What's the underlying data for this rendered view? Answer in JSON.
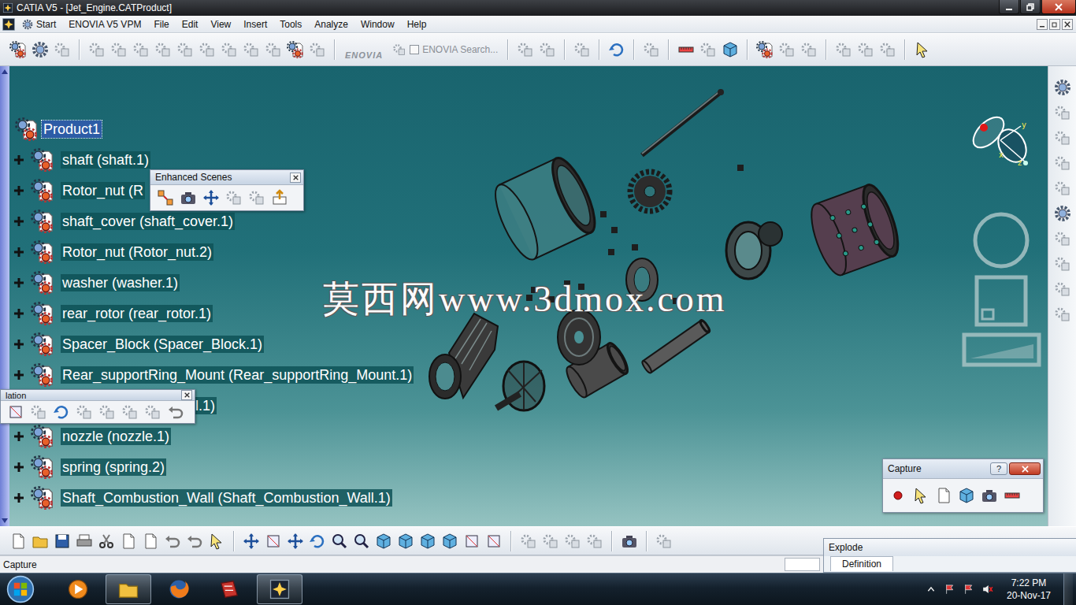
{
  "window": {
    "title": "CATIA V5 - [Jet_Engine.CATProduct]"
  },
  "menu": [
    "Start",
    "ENOVIA V5 VPM",
    "File",
    "Edit",
    "View",
    "Insert",
    "Tools",
    "Analyze",
    "Window",
    "Help"
  ],
  "toolbar": {
    "logo": "ENOVIA",
    "search": {
      "label": "ENOVIA Search...",
      "checked": false,
      "disabled": true
    }
  },
  "tree": {
    "root": {
      "label": "Product1",
      "selected": true
    },
    "items": [
      {
        "label": "shaft (shaft.1)",
        "kind": "row",
        "expanded": false
      },
      {
        "label": "Rotor_nut (R",
        "kind": "row",
        "expanded": false
      },
      {
        "label": "shaft_cover (shaft_cover.1)",
        "kind": "row",
        "expanded": false
      },
      {
        "label": "Rotor_nut (Rotor_nut.2)",
        "kind": "row",
        "expanded": false
      },
      {
        "label": "washer (washer.1)",
        "kind": "row",
        "expanded": false
      },
      {
        "label": "rear_rotor (rear_rotor.1)",
        "kind": "row",
        "expanded": false
      },
      {
        "label": "Spacer_Block (Spacer_Block.1)",
        "kind": "row",
        "expanded": false
      },
      {
        "label": "Rear_supportRing_Mount (Rear_supportRing_Mount.1)",
        "kind": "row",
        "expanded": false
      },
      {
        "label": "l.1)",
        "kind": "obscured",
        "expanded": false
      },
      {
        "label": "nozzle (nozzle.1)",
        "kind": "row",
        "expanded": false
      },
      {
        "label": "spring (spring.2)",
        "kind": "row",
        "expanded": false
      },
      {
        "label": "Shaft_Combustion_Wall (Shaft_Combustion_Wall.1)",
        "kind": "row",
        "expanded": false
      }
    ]
  },
  "compass": {
    "axes": [
      "y",
      "x",
      "z"
    ]
  },
  "watermark": "莫西网www.3dmox.com",
  "enhanced_scenes": {
    "title": "Enhanced Scenes"
  },
  "manipulation": {
    "title": "lation"
  },
  "capture": {
    "title": "Capture",
    "help": "?"
  },
  "explode": {
    "title": "Explode",
    "tab": "Definition"
  },
  "status_bar": {
    "text": "Capture"
  },
  "taskbar": {
    "time": "7:22 PM",
    "date": "20-Nov-17"
  }
}
